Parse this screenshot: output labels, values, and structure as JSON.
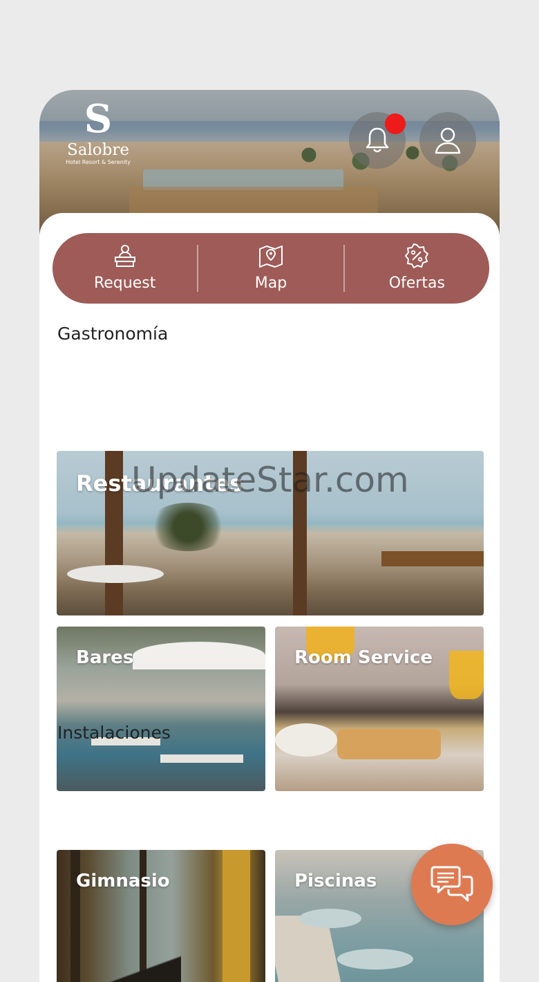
{
  "brand": {
    "initial": "S",
    "name": "Salobre",
    "tagline": "Hotel Resort & Serenity"
  },
  "header": {
    "notification_badge_color": "#ee1b1b",
    "icons": [
      "bell-icon",
      "user-icon"
    ]
  },
  "quick_actions": [
    {
      "label": "Request",
      "icon": "reception-desk-icon"
    },
    {
      "label": "Map",
      "icon": "map-pin-icon"
    },
    {
      "label": "Ofertas",
      "icon": "discount-badge-icon"
    }
  ],
  "sections": [
    {
      "title": "Gastronomía",
      "cards": [
        "Restaurantes",
        "Bares",
        "Room Service"
      ]
    },
    {
      "title": "Instalaciones",
      "cards": [
        "Gimnasio",
        "Piscinas"
      ]
    }
  ],
  "watermark": "UpdateStar.com",
  "colors": {
    "accent": "#9e5b57",
    "fab": "#de7a52",
    "background": "#ebebeb"
  },
  "fab": {
    "icon": "chat-bubbles-icon"
  }
}
